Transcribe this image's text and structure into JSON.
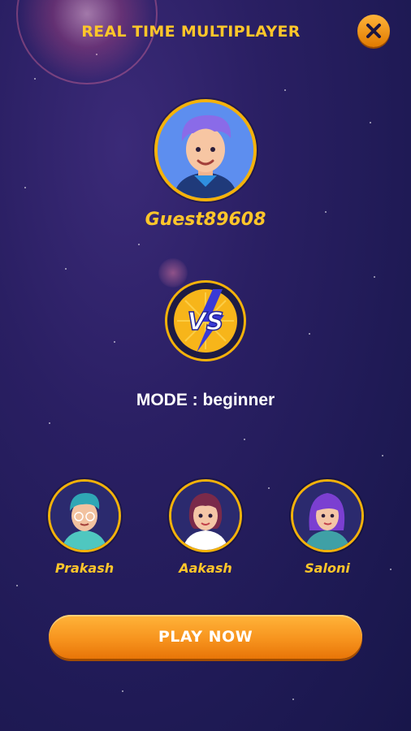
{
  "header": {
    "title": "REAL TIME MULTIPLAYER",
    "close_icon": "close-icon"
  },
  "player": {
    "name": "Guest89608",
    "avatar_icon": "boy-avatar-icon"
  },
  "versus": {
    "badge_text": "VS"
  },
  "mode": {
    "text": "MODE : beginner"
  },
  "opponents": [
    {
      "name": "Prakash",
      "avatar_icon": "glasses-boy-avatar-icon"
    },
    {
      "name": "Aakash",
      "avatar_icon": "girl-avatar-icon"
    },
    {
      "name": "Saloni",
      "avatar_icon": "purple-hair-girl-avatar-icon"
    }
  ],
  "actions": {
    "play_label": "PLAY NOW"
  },
  "colors": {
    "accent": "#ffc62a",
    "ring": "#f4b20a",
    "button": "#f7941e",
    "background": "#231c5a"
  }
}
